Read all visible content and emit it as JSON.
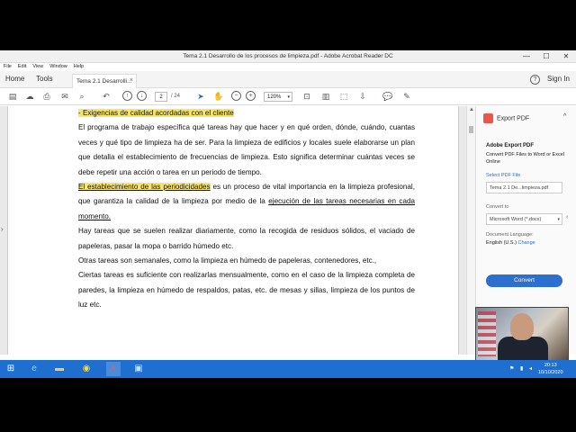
{
  "window": {
    "title": "Tema 2.1 Desarrollo de los procesos de limpieza.pdf - Adobe Acrobat Reader DC",
    "minimize": "—",
    "maximize": "☐",
    "close": "✕"
  },
  "menu": [
    "File",
    "Edit",
    "View",
    "Window",
    "Help"
  ],
  "nav": {
    "home": "Home",
    "tools": "Tools",
    "doc_tab": "Tema 2.1 Desarrolli...",
    "doc_tab_close": "×",
    "help": "?",
    "signin": "Sign In"
  },
  "toolbar": {
    "page_current": "2",
    "page_total": "/ 24",
    "zoom": "120%"
  },
  "document": {
    "heading": "- Exigencias de calidad acordadas con el cliente",
    "para1": "El programa de trabajo específica qué tareas hay que hacer y en qué orden, dónde, cuándo, cuantas veces y qué tipo de limpieza ha de ser. Para la limpieza de edificios y locales suele elaborarse un plan que detalla el establecimiento de frecuencias de limpieza. Esto significa determinar cuántas veces se debe repetir una acción o tarea en un periodo de tiempo.",
    "para2_hl": "El establecimiento de las periodicidades",
    "para2_a": " es un proceso de vital importancia en la limpieza profesional, que garantiza la calidad de la limpieza por medio de la ",
    "para2_ul": "ejecución de las tareas necesarias en cada momento.",
    "para3": "Hay tareas que se suelen realizar diariamente, como la recogida de residuos sólidos, el vaciado de papeleras, pasar la mopa o barrido húmedo etc.",
    "para4": "Otras tareas son semanales, como la limpieza en húmedo de papeleras, contenedores, etc.,",
    "para5": "Ciertas tareas es suficiente con realizarlas mensualmente, como en el caso de la limpieza completa de paredes, la limpieza en húmedo de respaldos, patas, etc. de mesas y sillas, limpieza de los puntos de luz etc."
  },
  "panel": {
    "title": "Export PDF",
    "section": "Adobe Export PDF",
    "desc": "Convert PDF Files to Word or Excel Online",
    "select_label": "Select PDF File",
    "file": "Tema 2.1 De...limpieza.pdf",
    "convert_to": "Convert to",
    "format": "Microsoft Word (*.docx)",
    "lang_label": "Document Language:",
    "lang_value": "English (U.S.)",
    "change": "Change",
    "convert_btn": "Convert"
  },
  "taskbar": {
    "time": "20:13",
    "date": "10/10/2020"
  },
  "colors": {
    "highlight": "#f7e56b",
    "accent": "#2c6fce",
    "taskbar": "#1f6fd1"
  }
}
